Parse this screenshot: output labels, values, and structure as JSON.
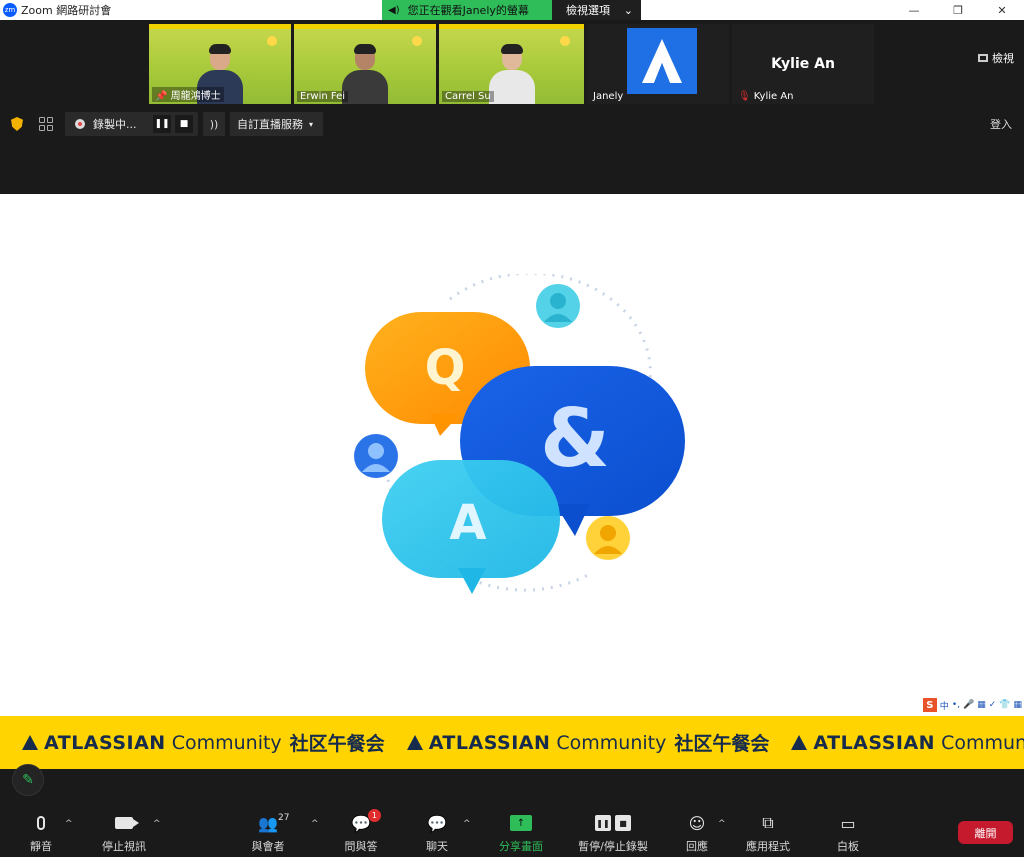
{
  "window": {
    "app_logo_text": "zm",
    "title": "Zoom 網路研討會",
    "minimize": "—",
    "maximize": "❐",
    "close": "✕"
  },
  "viewing_banner": {
    "text": "您正在觀看Janely的螢幕",
    "options_label": "檢視選項",
    "options_caret": "⌄"
  },
  "gallery": {
    "tiles": [
      {
        "name": "周龍鴻博士",
        "pinned": true
      },
      {
        "name": "Erwin Fei"
      },
      {
        "name": "Carrel Su"
      },
      {
        "name": "Janely"
      },
      {
        "name": "Kylie An",
        "display_name": "Kylie An",
        "muted": true
      }
    ],
    "view_label": "檢視"
  },
  "recording": {
    "label": "錄製中...",
    "pause": "❚❚",
    "stop": "■",
    "stream_icon": "))",
    "custom_live_label": "自訂直播服務",
    "caret": "▾",
    "signin_label": "登入"
  },
  "share": {
    "qa_letters": {
      "q": "Q",
      "amp": "&",
      "a": "A"
    },
    "ime": [
      "中",
      "•,",
      "🎤",
      "▦",
      "✓",
      "👕",
      "▦"
    ],
    "banner_items": [
      {
        "brand": "ATLASSIAN",
        "community": "Community",
        "cn": "社区午餐会"
      },
      {
        "brand": "ATLASSIAN",
        "community": "Community",
        "cn": "社区午餐会"
      },
      {
        "brand": "ATLASSIAN",
        "community": "Community",
        "cn": ""
      }
    ]
  },
  "annotate": {
    "icon": "✎"
  },
  "toolbar": {
    "mute_label": "靜音",
    "video_label": "停止視訊",
    "participants_label": "與會者",
    "participants_count": "27",
    "qa_label": "問與答",
    "qa_badge": "1",
    "chat_label": "聊天",
    "share_label": "分享畫面",
    "pause_record_label": "暫停/停止錄製",
    "reactions_label": "回應",
    "apps_label": "應用程式",
    "whiteboard_label": "白板",
    "leave_label": "離開",
    "caret": "^"
  },
  "colors": {
    "green": "#2ebd59",
    "leave_red": "#c5192d",
    "banner_yellow": "#ffd400",
    "atlassian_navy": "#172b4d",
    "atlassian_blue": "#1f6fe5"
  }
}
